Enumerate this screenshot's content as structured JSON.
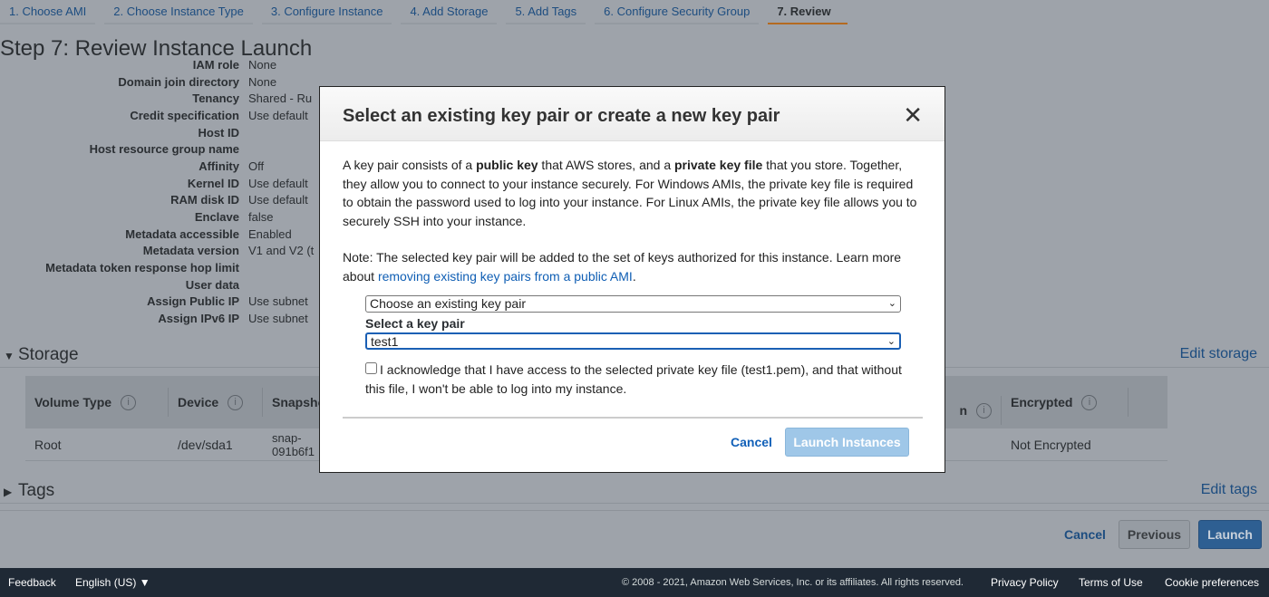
{
  "tabs": [
    "1. Choose AMI",
    "2. Choose Instance Type",
    "3. Configure Instance",
    "4. Add Storage",
    "5. Add Tags",
    "6. Configure Security Group",
    "7. Review"
  ],
  "page_title": "Step 7: Review Instance Launch",
  "details": [
    {
      "label": "IAM role",
      "value": "None"
    },
    {
      "label": "Domain join directory",
      "value": "None"
    },
    {
      "label": "Tenancy",
      "value": "Shared - Ru"
    },
    {
      "label": "Credit specification",
      "value": "Use default"
    },
    {
      "label": "Host ID",
      "value": ""
    },
    {
      "label": "Host resource group name",
      "value": ""
    },
    {
      "label": "Affinity",
      "value": "Off"
    },
    {
      "label": "Kernel ID",
      "value": "Use default"
    },
    {
      "label": "RAM disk ID",
      "value": "Use default"
    },
    {
      "label": "Enclave",
      "value": "false"
    },
    {
      "label": "Metadata accessible",
      "value": "Enabled"
    },
    {
      "label": "Metadata version",
      "value": "V1 and V2 (t"
    },
    {
      "label": "Metadata token response hop limit",
      "value": ""
    },
    {
      "label": "User data",
      "value": ""
    },
    {
      "label": "Assign Public IP",
      "value": "Use subnet"
    },
    {
      "label": "Assign IPv6 IP",
      "value": "Use subnet"
    }
  ],
  "storage": {
    "title": "Storage",
    "edit": "Edit storage",
    "headers": [
      "Volume Type",
      "Device",
      "Snapsho",
      "n",
      "Encrypted"
    ],
    "row": {
      "volume_type": "Root",
      "device": "/dev/sda1",
      "snapshot_1": "snap-",
      "snapshot_2": "091b6f1",
      "encrypted": "Not Encrypted"
    }
  },
  "tags": {
    "title": "Tags",
    "edit": "Edit tags"
  },
  "actions": {
    "cancel": "Cancel",
    "previous": "Previous",
    "launch": "Launch"
  },
  "footer": {
    "feedback": "Feedback",
    "language": "English (US)",
    "copyright": "© 2008 - 2021, Amazon Web Services, Inc. or its affiliates. All rights reserved.",
    "privacy": "Privacy Policy",
    "terms": "Terms of Use",
    "cookies": "Cookie preferences"
  },
  "modal": {
    "title": "Select an existing key pair or create a new key pair",
    "p1_a": "A key pair consists of a ",
    "p1_b": "public key",
    "p1_c": " that AWS stores, and a ",
    "p1_d": "private key file",
    "p1_e": " that you store. Together, they allow you to connect to your instance securely. For Windows AMIs, the private key file is required to obtain the password used to log into your instance. For Linux AMIs, the private key file allows you to securely SSH into your instance.",
    "note": "Note: The selected key pair will be added to the set of keys authorized for this instance. Learn more about ",
    "note_link": "removing existing key pairs from a public AMI",
    "note_end": ".",
    "mode_select": "Choose an existing key pair",
    "keypair_label": "Select a key pair",
    "keypair_select": "test1",
    "ack": "I acknowledge that I have access to the selected private key file (test1.pem), and that without this file, I won't be able to log into my instance.",
    "ack_checked": false,
    "cancel": "Cancel",
    "launch": "Launch Instances"
  }
}
